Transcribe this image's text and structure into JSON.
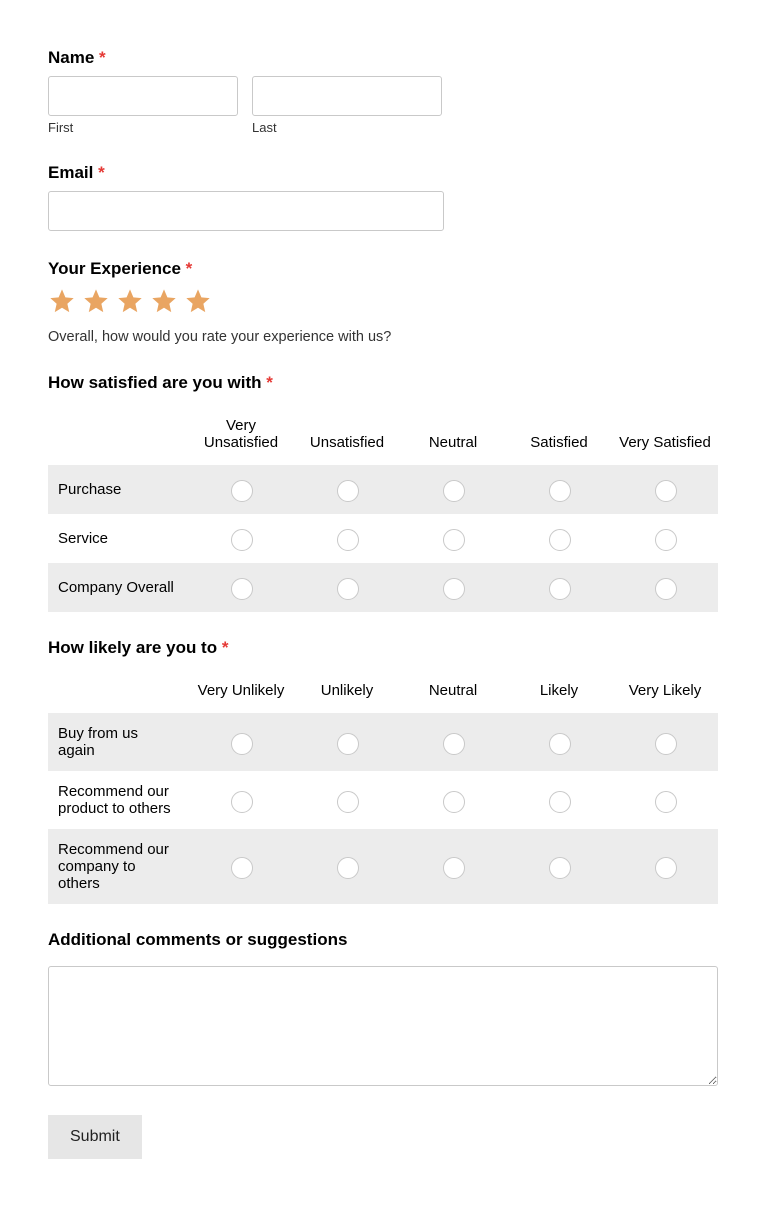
{
  "name": {
    "label": "Name",
    "required": "*",
    "first_label": "First",
    "last_label": "Last",
    "first_value": "",
    "last_value": ""
  },
  "email": {
    "label": "Email",
    "required": "*",
    "value": ""
  },
  "experience": {
    "label": "Your Experience",
    "required": "*",
    "stars_selected": 5,
    "helper": "Overall, how would you rate your experience with us?"
  },
  "satisfaction": {
    "label": "How satisfied are you with",
    "required": "*",
    "columns": [
      "Very Unsatisfied",
      "Unsatisfied",
      "Neutral",
      "Satisfied",
      "Very Satisfied"
    ],
    "rows": [
      "Purchase",
      "Service",
      "Company Overall"
    ]
  },
  "likelihood": {
    "label": "How likely are you to",
    "required": "*",
    "columns": [
      "Very Unlikely",
      "Unlikely",
      "Neutral",
      "Likely",
      "Very Likely"
    ],
    "rows": [
      "Buy from us again",
      "Recommend our product to others",
      "Recommend our company to others"
    ]
  },
  "comments": {
    "label": "Additional comments or suggestions",
    "value": ""
  },
  "submit": {
    "label": "Submit"
  }
}
